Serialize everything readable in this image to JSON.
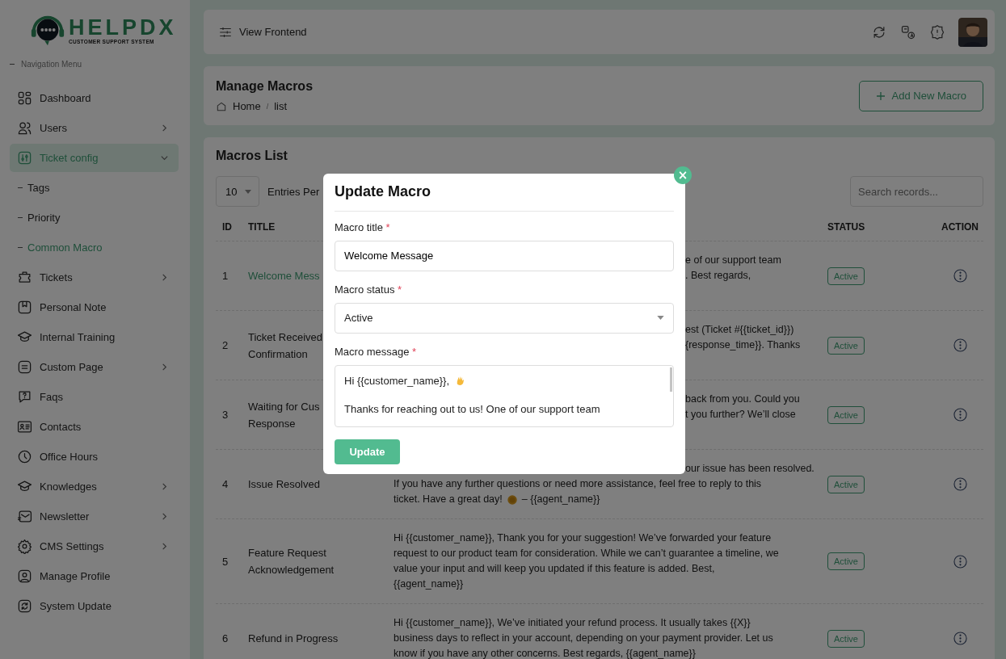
{
  "sidebar": {
    "logo": {
      "name": "HELPDX",
      "tagline": "CUSTOMER SUPPORT SYSTEM"
    },
    "section_label": "Navigation Menu",
    "items": [
      {
        "kind": "link",
        "label": "Dashboard",
        "selected": false
      },
      {
        "kind": "group",
        "label": "Users",
        "selected": false,
        "expanded": false
      },
      {
        "kind": "group",
        "label": "Ticket config",
        "selected": true,
        "expanded": true,
        "children": [
          {
            "label": "Tags",
            "selected": false
          },
          {
            "label": "Priority",
            "selected": false
          },
          {
            "label": "Common Macro",
            "selected": true
          }
        ]
      },
      {
        "kind": "group",
        "label": "Tickets",
        "selected": false,
        "expanded": false
      },
      {
        "kind": "link",
        "label": "Personal Note",
        "selected": false
      },
      {
        "kind": "link",
        "label": "Internal Training",
        "selected": false
      },
      {
        "kind": "group",
        "label": "Custom Page",
        "selected": false,
        "expanded": false
      },
      {
        "kind": "link",
        "label": "Faqs",
        "selected": false
      },
      {
        "kind": "link",
        "label": "Contacts",
        "selected": false
      },
      {
        "kind": "link",
        "label": "Office Hours",
        "selected": false
      },
      {
        "kind": "group",
        "label": "Knowledges",
        "selected": false,
        "expanded": false
      },
      {
        "kind": "group",
        "label": "Newsletter",
        "selected": false,
        "expanded": false
      },
      {
        "kind": "group",
        "label": "CMS Settings",
        "selected": false,
        "expanded": false
      },
      {
        "kind": "link",
        "label": "Manage Profile",
        "selected": false
      },
      {
        "kind": "link",
        "label": "System Update",
        "selected": false
      }
    ]
  },
  "topbar": {
    "link": "View Frontend"
  },
  "page_header": {
    "title": "Manage Macros",
    "breadcrumb": [
      "Home",
      "list"
    ],
    "breadcrumb_separator": "/",
    "add_button": "Add New Macro"
  },
  "macros_list": {
    "title": "Macros List",
    "entries": {
      "value": "10",
      "label": "Entries Per"
    },
    "search": {
      "placeholder": "Search records..."
    },
    "columns": {
      "id": "ID",
      "title": "TITLE",
      "status": "STATUS",
      "action": "ACTION"
    },
    "rows": [
      {
        "id": "1",
        "title": [
          "Welcome Mess"
        ],
        "selected": true,
        "status": "Active",
        "message": [
          {
            "text": "e of our support team",
            "covered": true
          },
          {
            "text": ". Best regards,",
            "covered": true
          }
        ]
      },
      {
        "id": "2",
        "title": [
          "Ticket Received",
          "Confirmation"
        ],
        "selected": false,
        "status": "Active",
        "message": [
          {
            "text": "est (Ticket #{{ticket_id}})",
            "covered": true
          },
          {
            "text": "{response_time}}. Thanks",
            "covered": true
          }
        ]
      },
      {
        "id": "3",
        "title": [
          "Waiting for Cus",
          "Response"
        ],
        "selected": false,
        "status": "Active",
        "message": [
          {
            "text": "back from you. Could you",
            "covered": true
          },
          {
            "text": "t you further? We’ll close",
            "covered": true
          }
        ]
      },
      {
        "id": "4",
        "title": [
          "Issue Resolved"
        ],
        "selected": false,
        "status": "Active",
        "message": [
          {
            "text": "our issue has been resolved.",
            "covered": true
          },
          {
            "text": "If you have any further questions or need more assistance, feel free to reply to this",
            "covered": false
          },
          {
            "text": "ticket. Have a great day!",
            "covered": false,
            "continuation": "– {{agent_name}}"
          }
        ]
      },
      {
        "id": "5",
        "title": [
          "Feature Request",
          "Acknowledgement"
        ],
        "selected": false,
        "status": "Active",
        "message": [
          {
            "text": "Hi {{customer_name}}, Thank you for your suggestion! We’ve forwarded your feature",
            "covered": false
          },
          {
            "text": "request to our product team for consideration. While we can’t guarantee a timeline, we",
            "covered": false
          },
          {
            "text": "value your input and will keep you updated if this feature is added. Best,",
            "covered": false
          },
          {
            "text": "{{agent_name}}",
            "covered": false
          }
        ]
      },
      {
        "id": "6",
        "title": [
          "Refund in Progress"
        ],
        "selected": false,
        "status": "Active",
        "message": [
          {
            "text": "Hi {{customer_name}}, We’ve initiated your refund process. It usually takes {{X}}",
            "covered": false
          },
          {
            "text": "business days to reflect in your account, depending on your payment provider. Let us",
            "covered": false
          },
          {
            "text": "know if you have any other concerns. Best regards, {{agent_name}}",
            "covered": false
          }
        ]
      }
    ]
  },
  "dialog": {
    "title": "Update Macro",
    "close": "×",
    "fields": [
      {
        "kind": "text",
        "label": "Macro title",
        "required_mark": "*",
        "value": "Welcome Message"
      },
      {
        "kind": "select",
        "label": "Macro status",
        "required_mark": "*",
        "value": "Active"
      },
      {
        "kind": "textarea",
        "label": "Macro message",
        "required_mark": "*",
        "paragraphs": [
          "Hi {{customer_name}},",
          "Thanks for reaching out to us! One of our support team"
        ]
      }
    ],
    "submit": "Update"
  }
}
